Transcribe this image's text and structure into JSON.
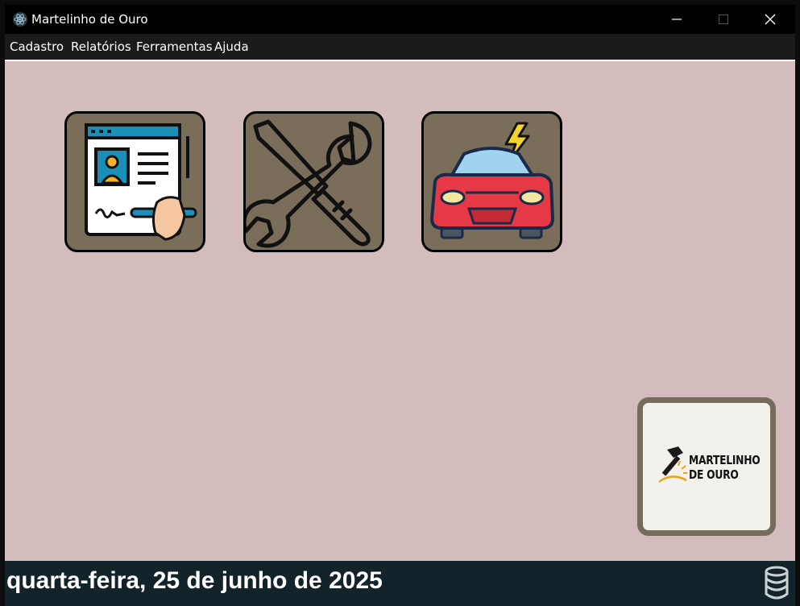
{
  "window": {
    "title": "Martelinho de Ouro"
  },
  "menu": {
    "items": [
      {
        "label": "Cadastro"
      },
      {
        "label": "Relatórios"
      },
      {
        "label": "Ferramentas"
      },
      {
        "label": "Ajuda"
      }
    ]
  },
  "tiles": [
    {
      "icon": "registration-form-icon"
    },
    {
      "icon": "tools-wrench-screwdriver-icon"
    },
    {
      "icon": "car-repair-icon"
    }
  ],
  "logo": {
    "line1": "MARTELINHO",
    "line2": "DE OURO"
  },
  "status": {
    "date": "quarta-feira, 25 de junho de 2025",
    "icon": "database-icon"
  },
  "colors": {
    "background": "#d3bcbb",
    "tile": "#7a6e5a",
    "statusbar": "#13232a",
    "logo_border": "#756c5c",
    "accent_gold": "#e7a51c"
  }
}
